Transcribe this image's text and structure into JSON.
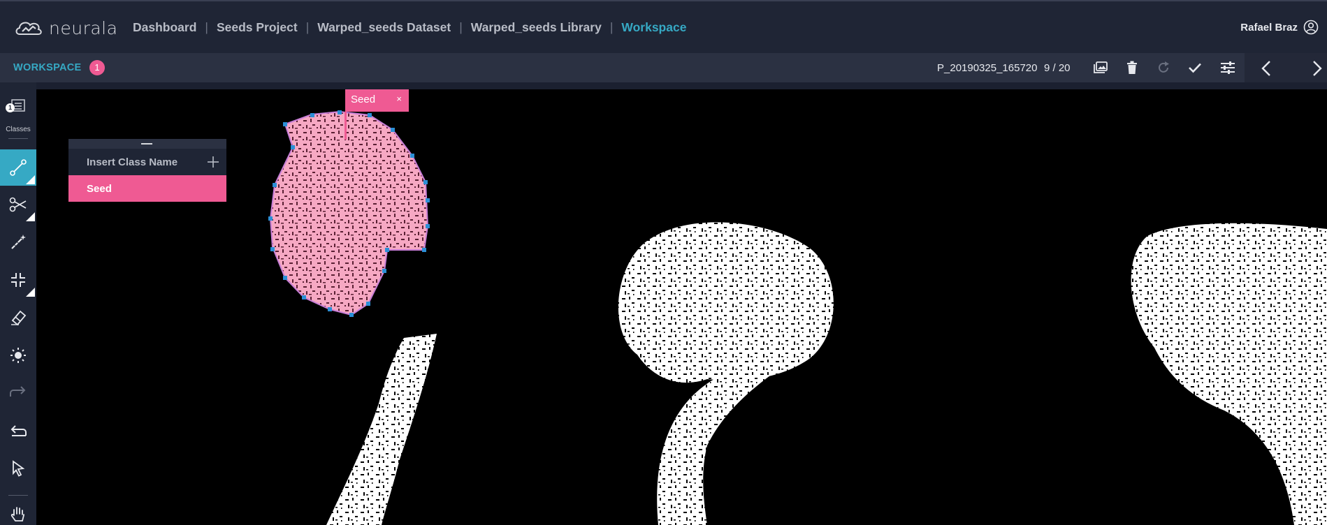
{
  "app": {
    "brand": "neurala"
  },
  "breadcrumbs": [
    "Dashboard",
    "Seeds Project",
    "Warped_seeds Dataset",
    "Warped_seeds Library",
    "Workspace"
  ],
  "user": {
    "name": "Rafael Braz"
  },
  "workspace": {
    "title": "WORKSPACE",
    "badge": "1"
  },
  "image": {
    "name": "P_20190325_165720",
    "counter": "9 / 20"
  },
  "sidebar": {
    "classes_label": "Classes",
    "classes_badge": "1"
  },
  "class_panel": {
    "placeholder": "Insert Class Name",
    "classes": [
      "Seed"
    ]
  },
  "annotation": {
    "label": "Seed",
    "close": "×"
  },
  "colors": {
    "accent": "#36a9c4",
    "pink": "#ef5a93",
    "nav_bg": "#1f2535"
  }
}
